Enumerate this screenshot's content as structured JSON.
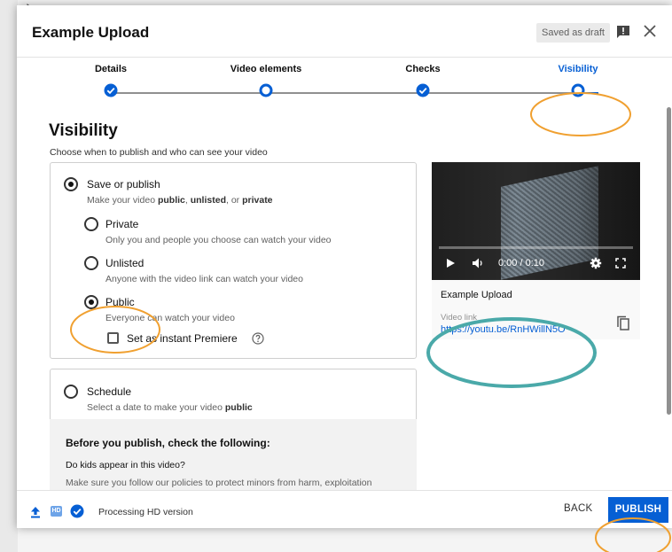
{
  "dialog": {
    "title": "Example Upload",
    "draft_badge": "Saved as draft"
  },
  "stepper": {
    "steps": [
      {
        "label": "Details",
        "state": "done"
      },
      {
        "label": "Video elements",
        "state": "current-incomplete"
      },
      {
        "label": "Checks",
        "state": "done"
      },
      {
        "label": "Visibility",
        "state": "active"
      }
    ]
  },
  "visibility": {
    "title": "Visibility",
    "subtitle": "Choose when to publish and who can see your video",
    "save_or_publish": {
      "label": "Save or publish",
      "desc_prefix": "Make your video ",
      "desc_public": "public",
      "desc_sep1": ", ",
      "desc_unlisted": "unlisted",
      "desc_sep2": ", or ",
      "desc_private": "private"
    },
    "options": [
      {
        "label": "Private",
        "desc": "Only you and people you choose can watch your video",
        "selected": false
      },
      {
        "label": "Unlisted",
        "desc": "Anyone with the video link can watch your video",
        "selected": false
      },
      {
        "label": "Public",
        "desc": "Everyone can watch your video",
        "selected": true
      }
    ],
    "premiere_label": "Set as instant Premiere",
    "schedule": {
      "label": "Schedule",
      "desc_prefix": "Select a date to make your video ",
      "desc_bold": "public"
    }
  },
  "checklist": {
    "title": "Before you publish, check the following:",
    "question": "Do kids appear in this video?",
    "cut_text": "Make sure you follow our policies to protect minors from harm, exploitation"
  },
  "preview": {
    "time": "0:00 / 0:10",
    "progress": 0,
    "title": "Example Upload",
    "link_label": "Video link",
    "link_url": "https://youtu.be/RnHWillN5O"
  },
  "footer": {
    "status": "Processing HD version",
    "hd_badge": "HD",
    "back_label": "BACK",
    "publish_label": "PUBLISH"
  },
  "colors": {
    "accent": "#065fd4",
    "annotation_orange": "#f0a030",
    "annotation_teal": "#4aa9a9"
  }
}
